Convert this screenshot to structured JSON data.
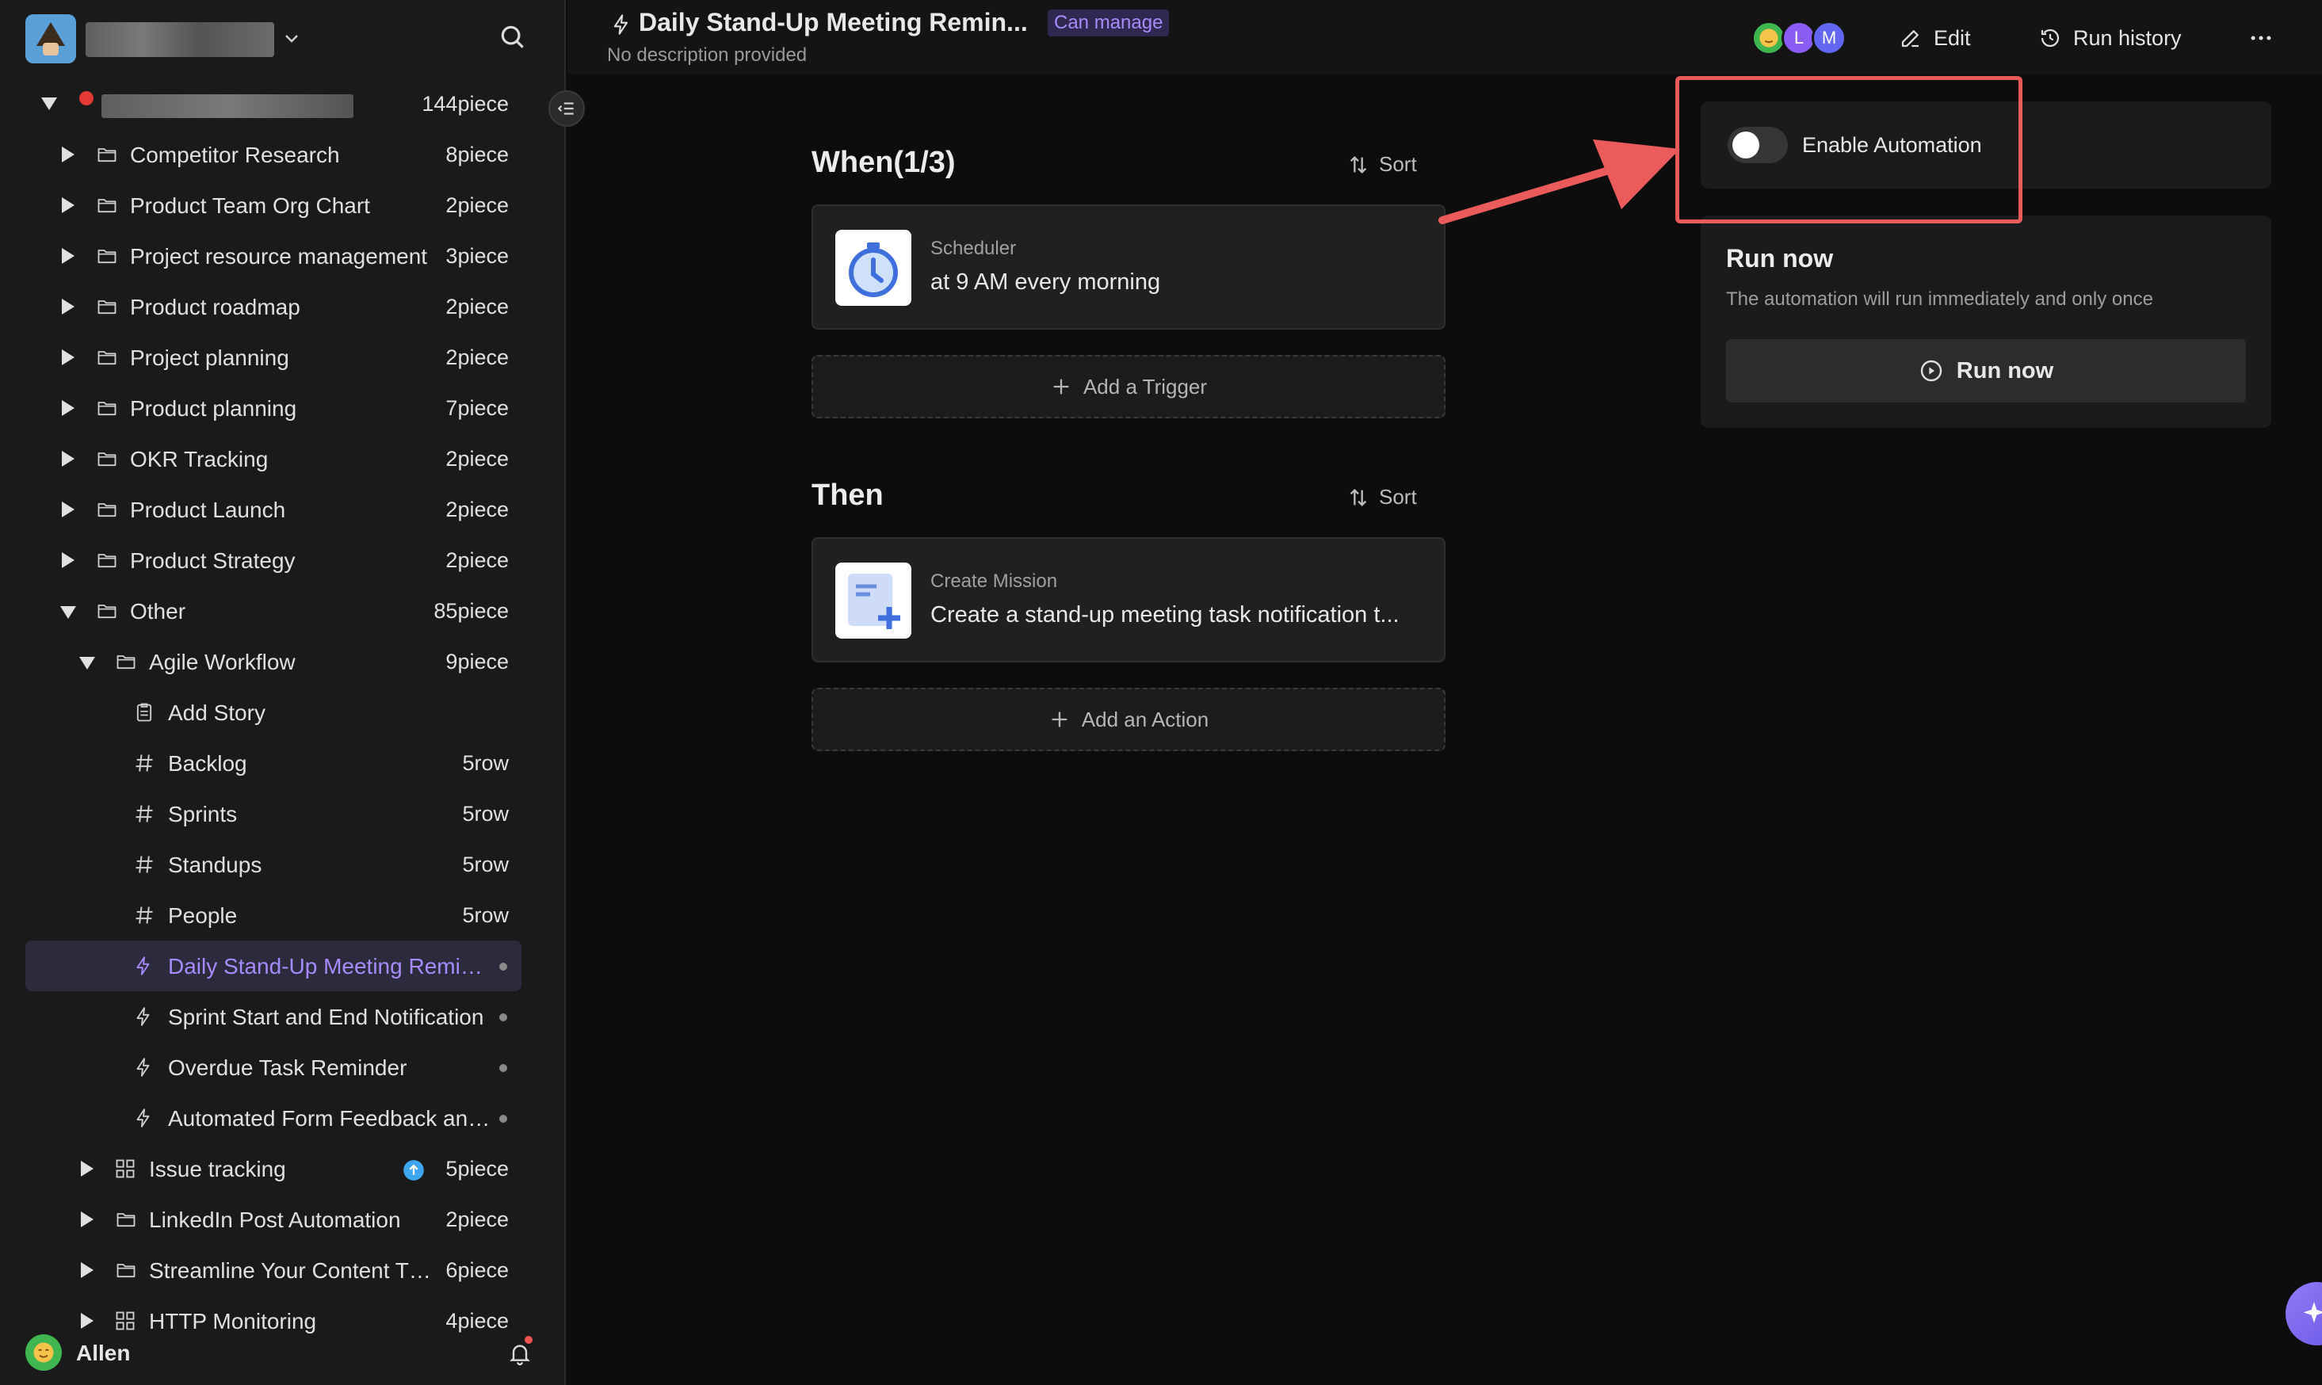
{
  "sidebar": {
    "root": {
      "label": "",
      "count": "144piece"
    },
    "items": [
      {
        "label": "Competitor Research",
        "count": "8piece"
      },
      {
        "label": "Product Team Org Chart",
        "count": "2piece"
      },
      {
        "label": "Project resource management",
        "count": "3piece"
      },
      {
        "label": "Product roadmap",
        "count": "2piece"
      },
      {
        "label": "Project planning",
        "count": "2piece"
      },
      {
        "label": "Product planning",
        "count": "7piece"
      },
      {
        "label": "OKR Tracking",
        "count": "2piece"
      },
      {
        "label": "Product Launch",
        "count": "2piece"
      },
      {
        "label": "Product Strategy",
        "count": "2piece"
      },
      {
        "label": "Other",
        "count": "85piece"
      },
      {
        "label": "Agile Workflow",
        "count": "9piece"
      },
      {
        "label": "Add Story",
        "count": ""
      },
      {
        "label": "Backlog",
        "count": "5row"
      },
      {
        "label": "Sprints",
        "count": "5row"
      },
      {
        "label": "Standups",
        "count": "5row"
      },
      {
        "label": "People",
        "count": "5row"
      },
      {
        "label": "Daily Stand-Up Meeting Remi…",
        "count": ""
      },
      {
        "label": "Sprint Start and End Notification",
        "count": ""
      },
      {
        "label": "Overdue Task Reminder",
        "count": ""
      },
      {
        "label": "Automated Form Feedback an…",
        "count": ""
      },
      {
        "label": "Issue tracking",
        "count": "5piece"
      },
      {
        "label": "LinkedIn Post Automation",
        "count": "2piece"
      },
      {
        "label": "Streamline Your Content T…",
        "count": "6piece"
      },
      {
        "label": "HTTP Monitoring",
        "count": "4piece"
      }
    ],
    "user": {
      "name": "Allen"
    }
  },
  "header": {
    "title": "Daily Stand-Up Meeting Remin...",
    "permission": "Can manage",
    "description": "No description provided",
    "avatars": [
      "L",
      "M"
    ],
    "edit_label": "Edit",
    "history_label": "Run history"
  },
  "when": {
    "title": "When(1/3)",
    "sort_label": "Sort",
    "trigger": {
      "type": "Scheduler",
      "desc": "at 9 AM every morning"
    },
    "add_label": "Add a Trigger"
  },
  "then": {
    "title": "Then",
    "sort_label": "Sort",
    "action": {
      "type": "Create Mission",
      "desc": "Create a stand-up meeting task notification t..."
    },
    "add_label": "Add an Action"
  },
  "panel": {
    "enable_label": "Enable Automation",
    "enabled": false,
    "run_title": "Run now",
    "run_desc": "The automation will run immediately and only once",
    "run_button": "Run now"
  },
  "colors": {
    "accent": "#a78bfa",
    "highlight": "#ec5b5b"
  }
}
